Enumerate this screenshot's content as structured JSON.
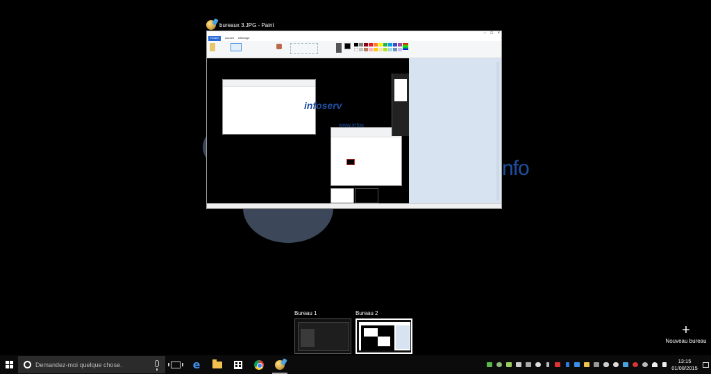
{
  "window": {
    "title": "bureaux 3.JPG - Paint",
    "app_icon": "paint-icon",
    "ribbon_tabs": [
      "Fichier",
      "Accueil",
      "Affichage"
    ]
  },
  "wallpaper": {
    "brand_text_1": "infoserv",
    "brand_text_2": "www.infos",
    "brand_text_3": "nfo"
  },
  "desktops": [
    {
      "label": "Bureau 1",
      "active": false
    },
    {
      "label": "Bureau 2",
      "active": true
    }
  ],
  "new_desktop": {
    "icon": "+",
    "label": "Nouveau bureau"
  },
  "taskbar": {
    "search_placeholder": "Demandez-moi quelque chose.",
    "pinned": [
      "task-view-icon",
      "edge-icon",
      "file-explorer-icon",
      "store-icon",
      "chrome-icon",
      "paint-icon"
    ]
  },
  "tray": {
    "icons": [
      "green-shield-icon",
      "cloud-icon",
      "chat-icon",
      "network-drive-icon",
      "keyboard-icon",
      "alien-icon",
      "usb-icon",
      "pdf-icon",
      "bluetooth-icon",
      "dropbox-icon",
      "folder-sync-icon",
      "drive-icon",
      "cat-icon",
      "cloud-sync-icon",
      "warning-icon",
      "antivirus-icon",
      "person-icon",
      "wifi-icon",
      "volume-icon"
    ],
    "time": "13:15",
    "date": "01/08/2015"
  },
  "colors": {
    "accent": "#2b6bd6",
    "wallpaper_blue": "#1f4fa0",
    "taskbar": "#0b0b0b"
  }
}
